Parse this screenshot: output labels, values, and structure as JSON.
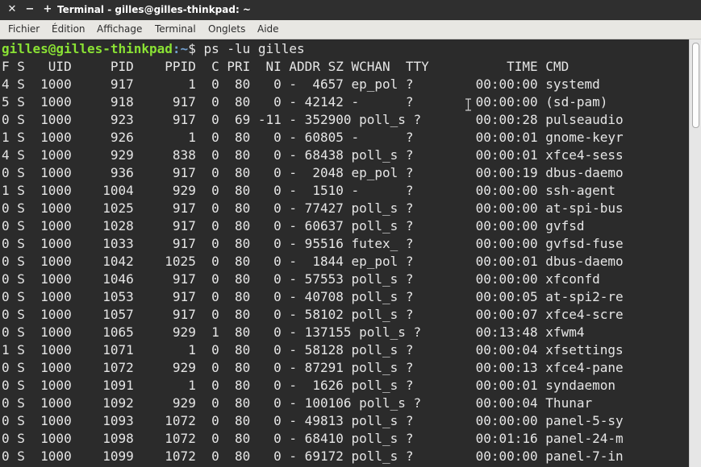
{
  "window": {
    "title": "Terminal - gilles@gilles-thinkpad: ~",
    "close_glyph": "✕",
    "minimize_glyph": "−",
    "maximize_glyph": "+"
  },
  "menu": [
    "Fichier",
    "Édition",
    "Affichage",
    "Terminal",
    "Onglets",
    "Aide"
  ],
  "terminal": {
    "prompt_user": "gilles@gilles-thinkpad",
    "prompt_path": ":~",
    "prompt_symbol": "$ ",
    "command": "ps -lu gilles",
    "lines": [
      "F S   UID     PID    PPID  C PRI  NI ADDR SZ WCHAN  TTY          TIME CMD",
      "4 S  1000     917       1  0  80   0 -  4657 ep_pol ?        00:00:00 systemd",
      "5 S  1000     918     917  0  80   0 - 42142 -      ?        00:00:00 (sd-pam)",
      "0 S  1000     923     917  0  69 -11 - 352900 poll_s ?       00:00:28 pulseaudio",
      "1 S  1000     926       1  0  80   0 - 60805 -      ?        00:00:01 gnome-keyr",
      "4 S  1000     929     838  0  80   0 - 68438 poll_s ?        00:00:01 xfce4-sess",
      "0 S  1000     936     917  0  80   0 -  2048 ep_pol ?        00:00:19 dbus-daemo",
      "1 S  1000    1004     929  0  80   0 -  1510 -      ?        00:00:00 ssh-agent",
      "0 S  1000    1025     917  0  80   0 - 77427 poll_s ?        00:00:00 at-spi-bus",
      "0 S  1000    1028     917  0  80   0 - 60637 poll_s ?        00:00:00 gvfsd",
      "0 S  1000    1033     917  0  80   0 - 95516 futex_ ?        00:00:00 gvfsd-fuse",
      "0 S  1000    1042    1025  0  80   0 -  1844 ep_pol ?        00:00:01 dbus-daemo",
      "0 S  1000    1046     917  0  80   0 - 57553 poll_s ?        00:00:00 xfconfd",
      "0 S  1000    1053     917  0  80   0 - 40708 poll_s ?        00:00:05 at-spi2-re",
      "0 S  1000    1057     917  0  80   0 - 58102 poll_s ?        00:00:07 xfce4-scre",
      "0 S  1000    1065     929  1  80   0 - 137155 poll_s ?       00:13:48 xfwm4",
      "1 S  1000    1071       1  0  80   0 - 58128 poll_s ?        00:00:04 xfsettings",
      "0 S  1000    1072     929  0  80   0 - 87291 poll_s ?        00:00:13 xfce4-pane",
      "0 S  1000    1091       1  0  80   0 -  1626 poll_s ?        00:00:01 syndaemon",
      "0 S  1000    1092     929  0  80   0 - 100106 poll_s ?       00:00:04 Thunar",
      "0 S  1000    1093    1072  0  80   0 - 49813 poll_s ?        00:00:00 panel-5-sy",
      "0 S  1000    1098    1072  0  80   0 - 68410 poll_s ?        00:01:16 panel-24-m",
      "0 S  1000    1099    1072  0  80   0 - 69172 poll_s ?        00:00:00 panel-7-in"
    ]
  },
  "colors": {
    "terminal_bg": "#2b2b2b",
    "terminal_fg": "#e6e6e6",
    "prompt_user": "#8ae234",
    "prompt_path": "#729fcf",
    "titlebar_bg": "#2f2f2f",
    "menubar_bg": "#e8e7e3"
  }
}
